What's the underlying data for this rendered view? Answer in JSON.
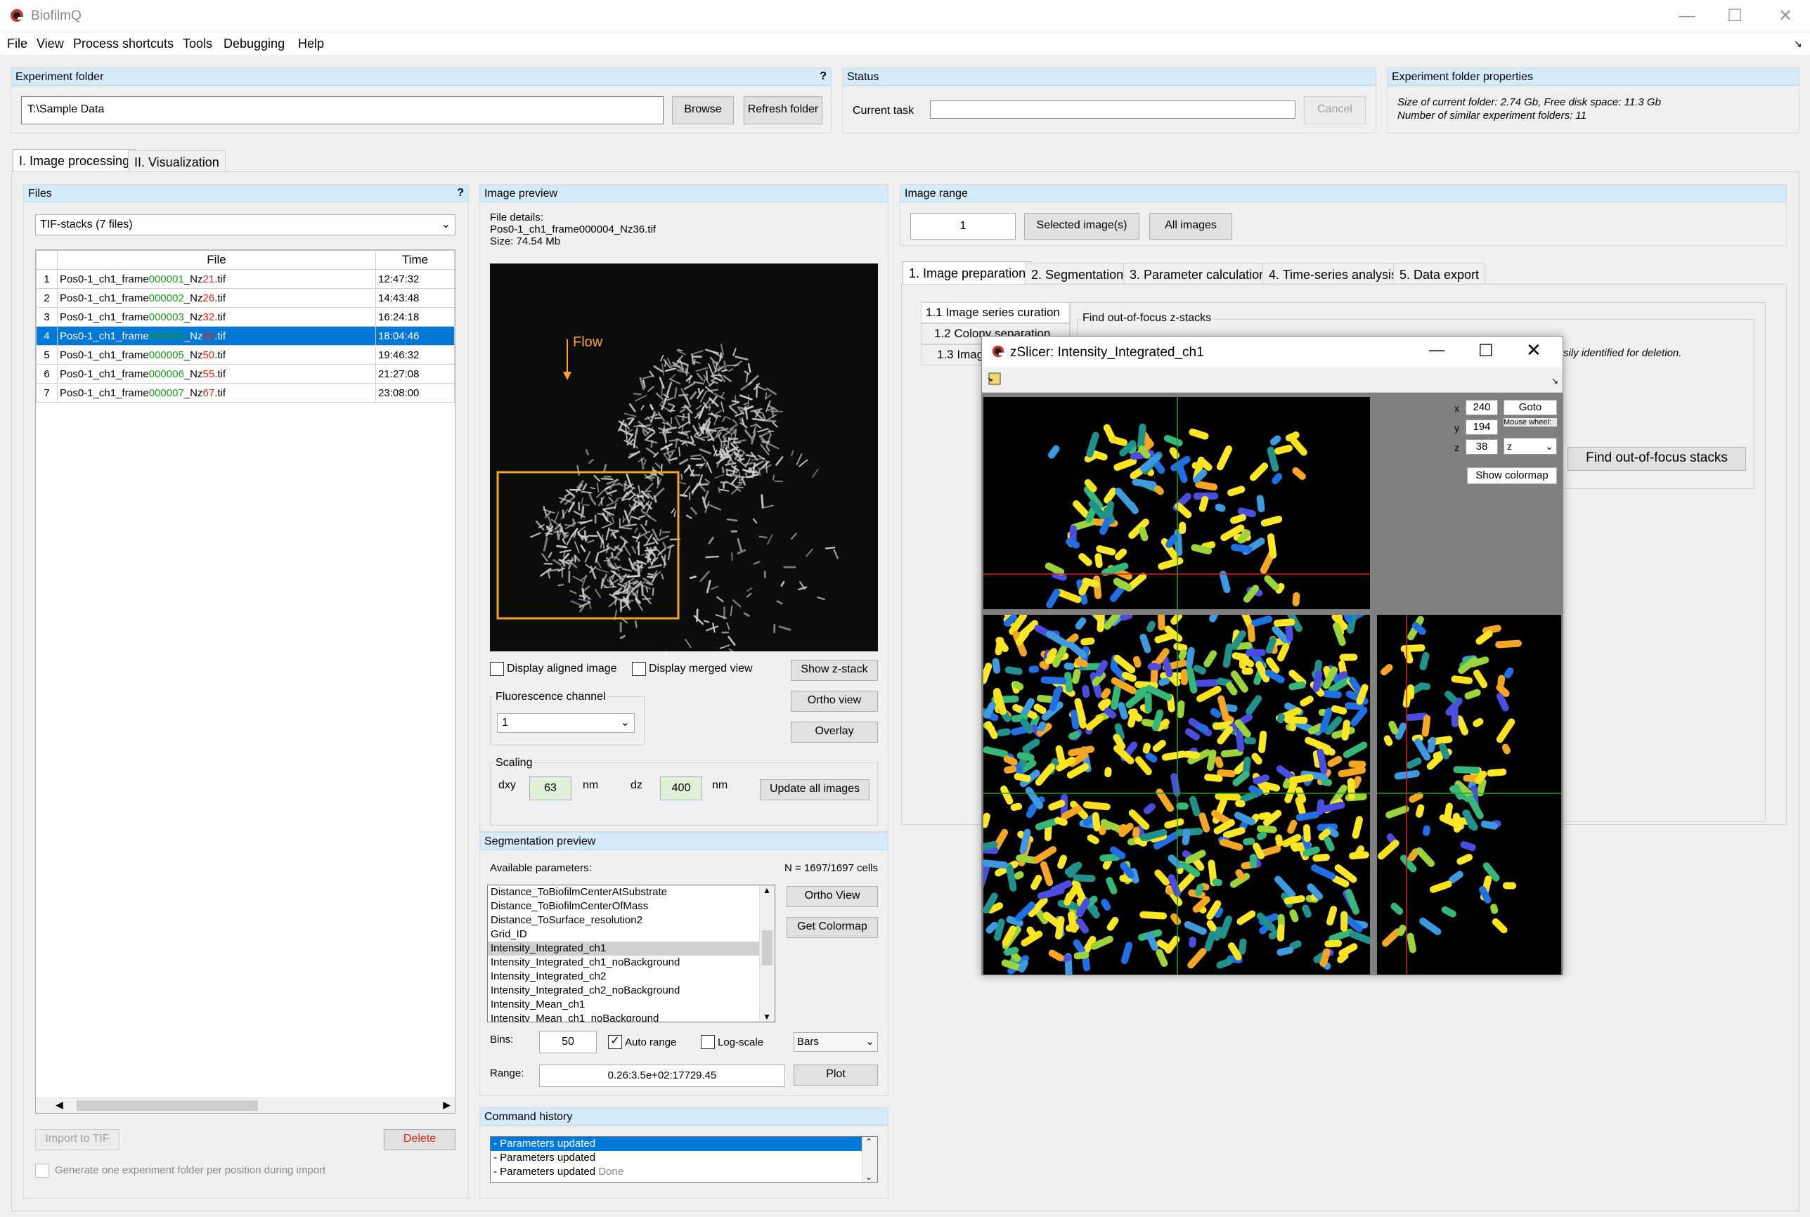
{
  "app": {
    "title": "BiofilmQ"
  },
  "menu": [
    "File",
    "View",
    "Process shortcuts",
    "Tools",
    "Debugging",
    "Help"
  ],
  "experiment_folder": {
    "header": "Experiment folder",
    "help": "?",
    "path": "T:\\Sample Data",
    "browse": "Browse",
    "refresh": "Refresh folder"
  },
  "status": {
    "header": "Status",
    "current_task": "Current task",
    "cancel": "Cancel"
  },
  "folder_props": {
    "header": "Experiment folder properties",
    "line1": "Size of current folder: 2.74 Gb, Free disk space: 11.3 Gb",
    "line2": "Number of similar experiment folders: 11"
  },
  "main_tabs": [
    "I. Image processing",
    "II. Visualization"
  ],
  "files": {
    "header": "Files",
    "help": "?",
    "type": "TIF-stacks (7 files)",
    "col_file": "File",
    "col_time": "Time",
    "rows": [
      {
        "n": "1",
        "pre": "Pos0-1_ch1_frame",
        "frame": "000001",
        "mid": "_Nz",
        "nz": "21",
        "ext": ".tif",
        "time": "12:47:32"
      },
      {
        "n": "2",
        "pre": "Pos0-1_ch1_frame",
        "frame": "000002",
        "mid": "_Nz",
        "nz": "26",
        "ext": ".tif",
        "time": "14:43:48"
      },
      {
        "n": "3",
        "pre": "Pos0-1_ch1_frame",
        "frame": "000003",
        "mid": "_Nz",
        "nz": "32",
        "ext": ".tif",
        "time": "16:24:18"
      },
      {
        "n": "4",
        "pre": "Pos0-1_ch1_frame",
        "frame": "000004",
        "mid": "_Nz",
        "nz": "36",
        "ext": ".tif",
        "time": "18:04:46"
      },
      {
        "n": "5",
        "pre": "Pos0-1_ch1_frame",
        "frame": "000005",
        "mid": "_Nz",
        "nz": "50",
        "ext": ".tif",
        "time": "19:46:32"
      },
      {
        "n": "6",
        "pre": "Pos0-1_ch1_frame",
        "frame": "000006",
        "mid": "_Nz",
        "nz": "55",
        "ext": ".tif",
        "time": "21:27:08"
      },
      {
        "n": "7",
        "pre": "Pos0-1_ch1_frame",
        "frame": "000007",
        "mid": "_Nz",
        "nz": "67",
        "ext": ".tif",
        "time": "23:08:00"
      }
    ],
    "import_btn": "Import to TIF",
    "delete_btn": "Delete",
    "gen_label": "Generate one experiment folder per position during import"
  },
  "preview": {
    "header": "Image preview",
    "details_label": "File details:",
    "details_file": "Pos0-1_ch1_frame000004_Nz36.tif",
    "details_size": "Size: 74.54 Mb",
    "flow": "Flow",
    "display_aligned": "Display aligned image",
    "display_merged": "Display merged view",
    "show_zstack": "Show z-stack",
    "ortho_view": "Ortho view",
    "overlay": "Overlay",
    "fluor_label": "Fluorescence channel",
    "fluor_value": "1",
    "scaling_label": "Scaling",
    "dxy_label": "dxy",
    "dxy": "63",
    "dz_label": "dz",
    "dz": "400",
    "unit": "nm",
    "update_all": "Update all images"
  },
  "seg_preview": {
    "header": "Segmentation preview",
    "available": "Available parameters:",
    "count": "N = 1697/1697 cells",
    "params": [
      "Distance_ToBiofilmCenterAtSubstrate",
      "Distance_ToBiofilmCenterOfMass",
      "Distance_ToSurface_resolution2",
      "Grid_ID",
      "Intensity_Integrated_ch1",
      "Intensity_Integrated_ch1_noBackground",
      "Intensity_Integrated_ch2",
      "Intensity_Integrated_ch2_noBackground",
      "Intensity_Mean_ch1",
      "Intensity_Mean_ch1_noBackground"
    ],
    "ortho_view": "Ortho View",
    "get_colormap": "Get Colormap",
    "bins_label": "Bins:",
    "bins": "50",
    "auto_range": "Auto range",
    "log_scale": "Log-scale",
    "plot_type": "Bars",
    "range_label": "Range:",
    "range": "0.26:3.5e+02:17729.45",
    "plot": "Plot"
  },
  "history": {
    "header": "Command history",
    "items": [
      "- Parameters updated",
      "- Parameters updated",
      "- Parameters updated"
    ],
    "done": "Done"
  },
  "image_range": {
    "header": "Image range",
    "value": "1",
    "selected": "Selected image(s)",
    "all": "All images"
  },
  "proc_tabs": [
    "1. Image preparation",
    "2. Segmentation",
    "3. Parameter calculation",
    "4. Time-series analysis",
    "5. Data export"
  ],
  "sub_tabs": [
    "1.1 Image series curation",
    "1.2 Colony separation",
    "1.3 Imag"
  ],
  "find_group": {
    "label": "Find out-of-focus z-stacks",
    "note": "sily identified for deletion.",
    "button": "Find out-of-focus stacks"
  },
  "zslicer": {
    "title": "zSlicer: Intensity_Integrated_ch1",
    "x_label": "x",
    "x": "240",
    "y_label": "y",
    "y": "194",
    "z_label": "z",
    "z": "38",
    "goto": "Goto",
    "mouse_wheel": "Mouse wheel:",
    "wheel_value": "z",
    "show_colormap": "Show colormap"
  },
  "colors": {
    "accent": "#0078d7",
    "header_bg": "#d6ebfa",
    "frame_green": "#1a9c1a",
    "nz_red": "#e32020",
    "roi_orange": "#f5a623"
  }
}
